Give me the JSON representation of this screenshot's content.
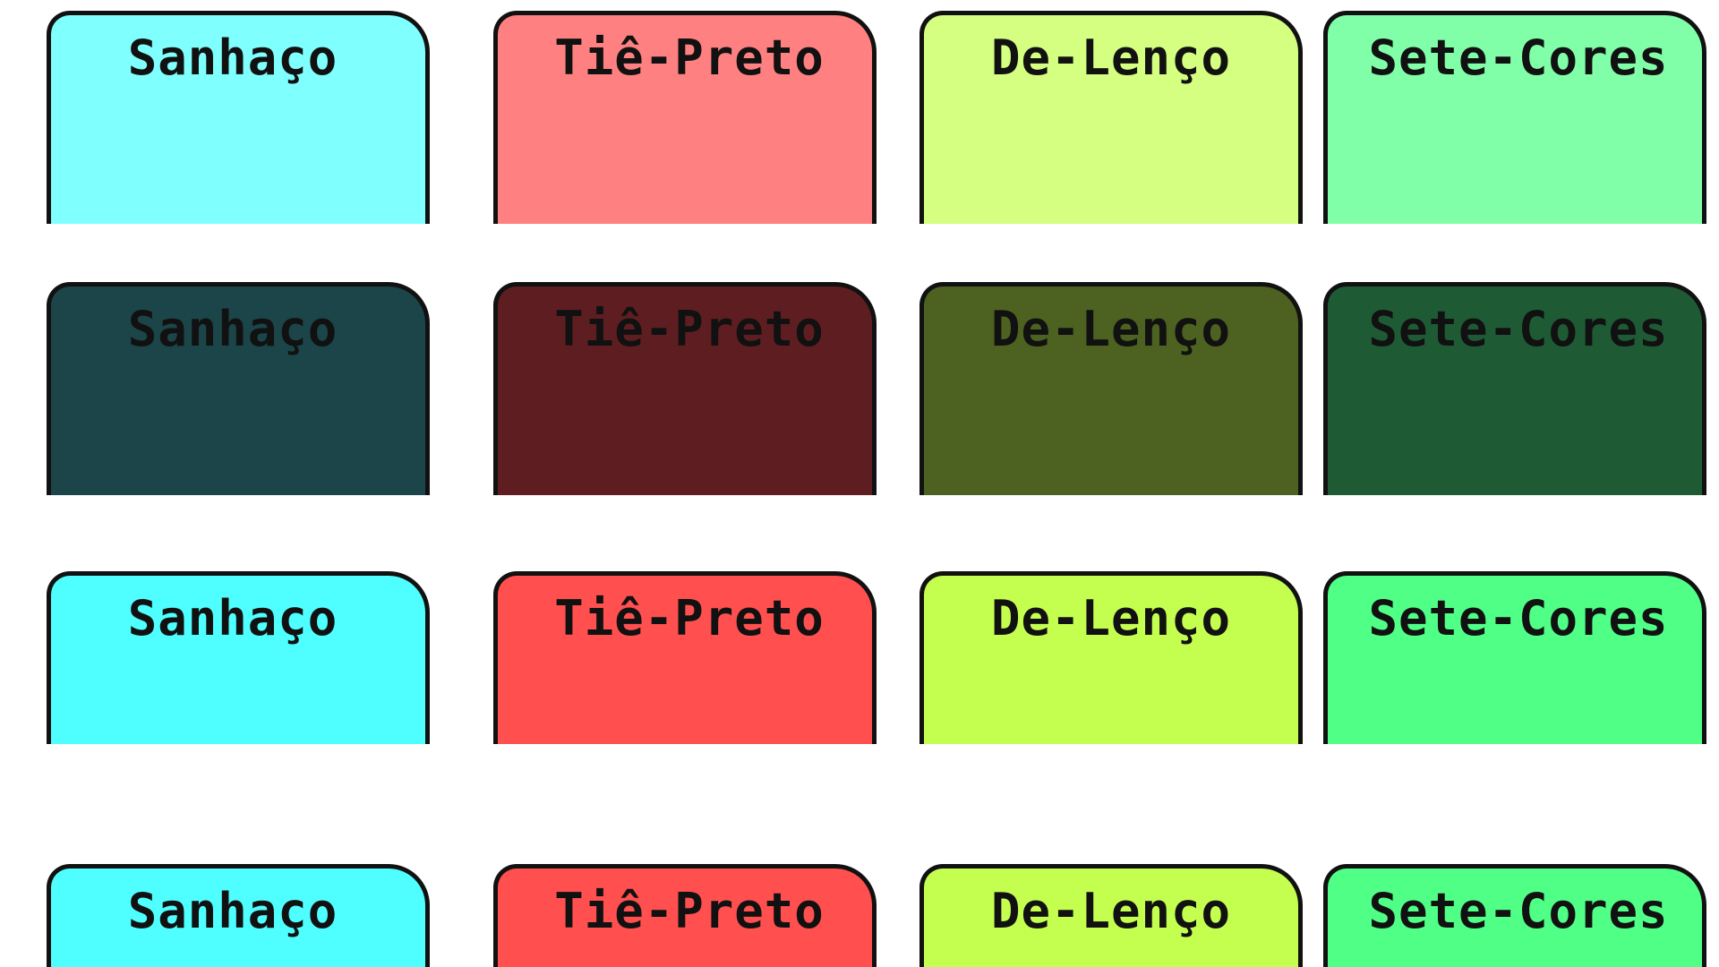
{
  "rows": [
    {
      "tabs": [
        {
          "label": "Sanhaço",
          "color": "#80ffff"
        },
        {
          "label": "Tiê-Preto",
          "color": "#ff8080"
        },
        {
          "label": "De-Lenço",
          "color": "#d4ff80"
        },
        {
          "label": "Sete-Cores",
          "color": "#80ffa8"
        }
      ]
    },
    {
      "tabs": [
        {
          "label": "Sanhaço",
          "color": "#1b4548"
        },
        {
          "label": "Tiê-Preto",
          "color": "#5e1e21"
        },
        {
          "label": "De-Lenço",
          "color": "#4d6220"
        },
        {
          "label": "Sete-Cores",
          "color": "#1e5b35"
        }
      ]
    },
    {
      "tabs": [
        {
          "label": "Sanhaço",
          "color": "#4fffff"
        },
        {
          "label": "Tiê-Preto",
          "color": "#ff4f4f"
        },
        {
          "label": "De-Lenço",
          "color": "#c4ff4f"
        },
        {
          "label": "Sete-Cores",
          "color": "#4fff86"
        }
      ]
    },
    {
      "tabs": [
        {
          "label": "Sanhaço",
          "color": "#4fffff"
        },
        {
          "label": "Tiê-Preto",
          "color": "#ff4f4f"
        },
        {
          "label": "De-Lenço",
          "color": "#c4ff4f"
        },
        {
          "label": "Sete-Cores",
          "color": "#4fff86"
        }
      ]
    }
  ]
}
